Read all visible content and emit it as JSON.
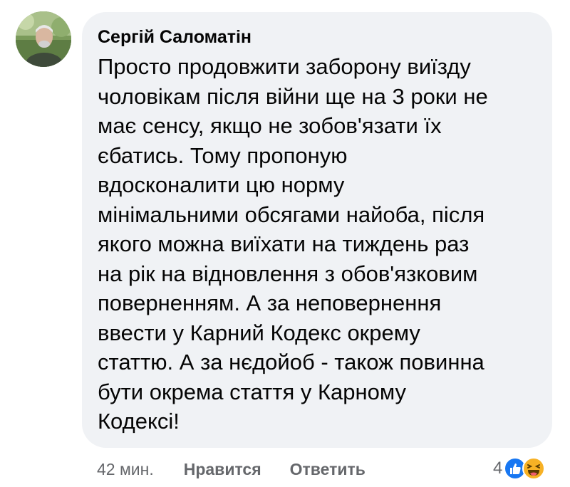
{
  "comment": {
    "author": "Сергій Саломатін",
    "text_lines": [
      "Просто продовжити заборону виїзду",
      "чоловікам після війни ще на 3 роки не",
      "має сенсу, якщо не зобов'язати їх",
      "єбатись. Тому пропоную",
      "вдосконалити цю норму",
      "мінімальними обсягами найоба, після",
      "якого можна виїхати на тиждень раз",
      "на рік на відновлення з обов'язковим",
      "поверненням. А за неповернення",
      "ввести у Карний Кодекс окрему",
      "статтю. А за нєдойоб - також повинна",
      "бути окрема стаття у Карному",
      "Кодексі!"
    ]
  },
  "actions": {
    "time": "42 мин.",
    "like_label": "Нравится",
    "reply_label": "Ответить"
  },
  "reactions": {
    "count": "4",
    "icons": [
      "like-icon",
      "haha-icon"
    ]
  },
  "colors": {
    "bubble": "#f0f2f5",
    "text": "#050505",
    "secondary": "#65676b",
    "like_blue": "#1877f2",
    "haha_yellow": "#f7b125"
  }
}
